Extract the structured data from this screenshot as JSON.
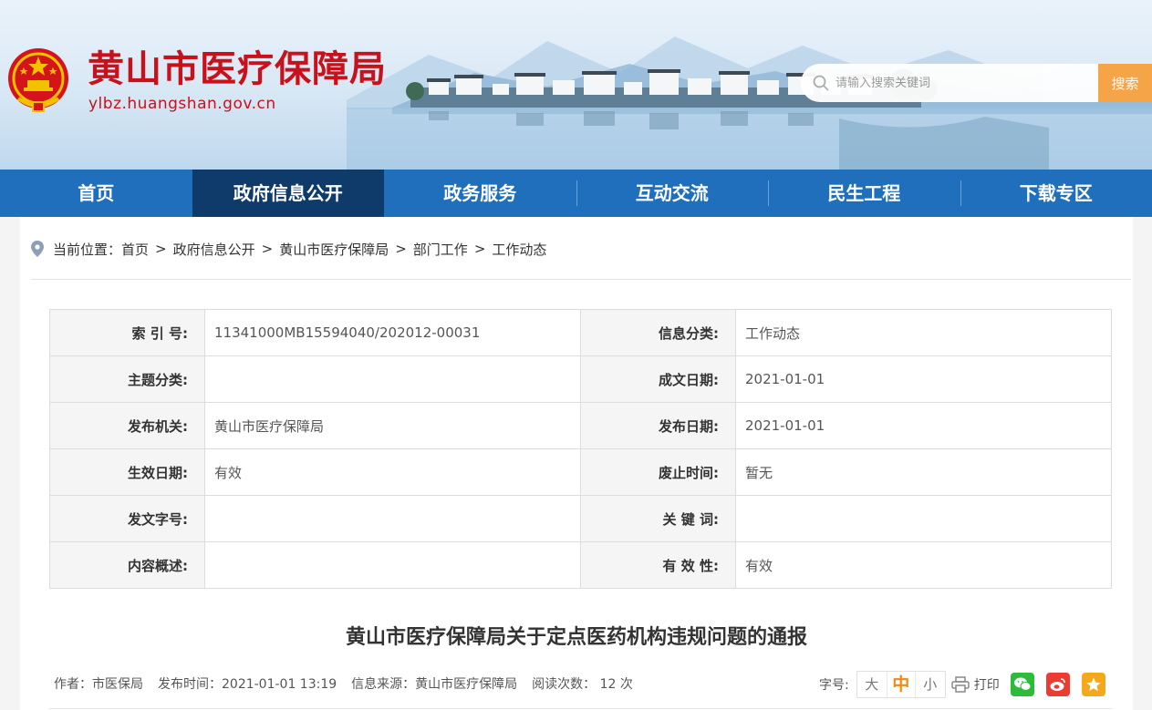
{
  "header": {
    "site_title": "黄山市医疗保障局",
    "site_domain": "ylbz.huangshan.gov.cn",
    "search_placeholder": "请输入搜索关键词",
    "search_button": "搜索"
  },
  "nav": {
    "items": [
      {
        "label": "首页"
      },
      {
        "label": "政府信息公开"
      },
      {
        "label": "政务服务"
      },
      {
        "label": "互动交流"
      },
      {
        "label": "民生工程"
      },
      {
        "label": "下载专区"
      }
    ],
    "active_index": 1
  },
  "breadcrumb": {
    "prefix": "当前位置：",
    "items": [
      "首页",
      "政府信息公开",
      "黄山市医疗保障局",
      "部门工作",
      "工作动态"
    ],
    "separator": ">"
  },
  "meta_table": {
    "rows": [
      {
        "k1": "索 引 号:",
        "v1": "11341000MB15594040/202012-00031",
        "k2": "信息分类:",
        "v2": "工作动态"
      },
      {
        "k1": "主题分类:",
        "v1": "",
        "k2": "成文日期:",
        "v2": "2021-01-01"
      },
      {
        "k1": "发布机关:",
        "v1": "黄山市医疗保障局",
        "k2": "发布日期:",
        "v2": "2021-01-01"
      },
      {
        "k1": "生效日期:",
        "v1": "有效",
        "k2": "废止时间:",
        "v2": "暂无"
      },
      {
        "k1": "发文字号:",
        "v1": "",
        "k2": "关 键 词:",
        "v2": ""
      },
      {
        "k1": "内容概述:",
        "v1": "",
        "k2": "有 效 性:",
        "v2": "有效"
      }
    ]
  },
  "article": {
    "title": "黄山市医疗保障局关于定点医药机构违规问题的通报",
    "author": "作者：市医保局",
    "publish_time": "发布时间：2021-01-01 13:19",
    "source": "信息来源：黄山市医疗保障局",
    "views": "阅读次数： 12 次"
  },
  "tools": {
    "font_size_label": "字号:",
    "font_large": "大",
    "font_medium": "中",
    "font_small": "小",
    "print_label": "打印"
  },
  "colors": {
    "brand_red": "#c8111b",
    "nav_blue": "#1f6fbd",
    "nav_active": "#0e3b6a",
    "search_orange": "#f5a448"
  }
}
